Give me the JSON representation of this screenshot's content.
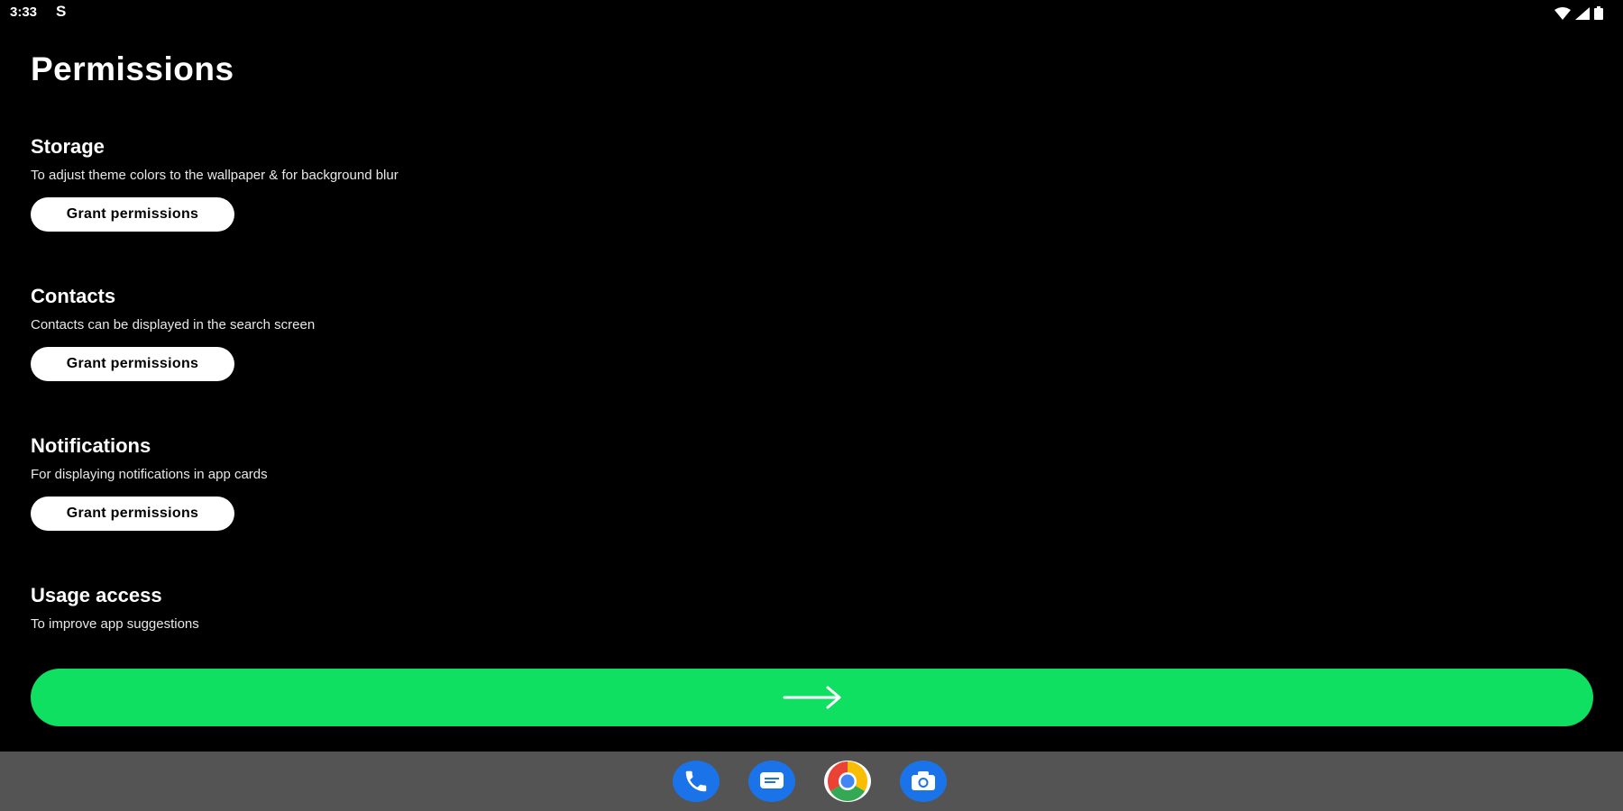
{
  "status_bar": {
    "time": "3:33",
    "notification_icon": "S"
  },
  "page": {
    "title": "Permissions"
  },
  "permissions": [
    {
      "heading": "Storage",
      "description": "To adjust theme colors to the wallpaper & for background blur",
      "button_label": "Grant permissions"
    },
    {
      "heading": "Contacts",
      "description": "Contacts can be displayed in the search screen",
      "button_label": "Grant permissions"
    },
    {
      "heading": "Notifications",
      "description": "For displaying notifications in app cards",
      "button_label": "Grant permissions"
    },
    {
      "heading": "Usage access",
      "description": "To improve app suggestions"
    }
  ],
  "next_button": {
    "icon": "arrow-right-icon"
  },
  "dock": {
    "apps": [
      "phone-icon",
      "messages-icon",
      "chrome-icon",
      "camera-icon"
    ]
  },
  "colors": {
    "background": "#000000",
    "accent": "#0fe061",
    "dock": "#545454",
    "button": "#ffffff"
  }
}
